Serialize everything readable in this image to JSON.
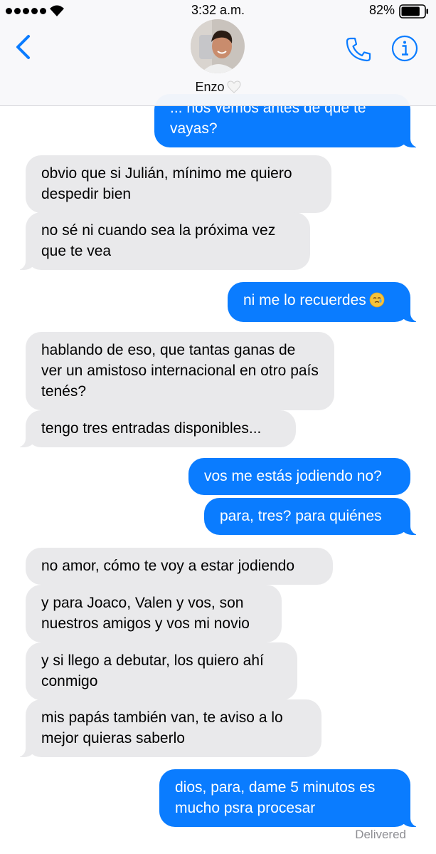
{
  "status_bar": {
    "time": "3:32 a.m.",
    "battery_percent": "82%",
    "battery_level": 0.82
  },
  "header": {
    "contact_name": "Enzo",
    "name_emoji_icon": "white-heart-icon",
    "back_icon": "chevron-left-icon",
    "call_icon": "phone-icon",
    "info_icon": "info-icon",
    "accent_color": "#0a7cff"
  },
  "messages": [
    {
      "from": "me",
      "text": "... nos vemos antes de que te vayas?"
    },
    {
      "from": "them",
      "text": "obvio que si Julián, mínimo me quiero despedir bien"
    },
    {
      "from": "them",
      "text": "no sé ni cuando sea la próxima vez que te vea"
    },
    {
      "from": "me",
      "text": "ni me lo recuerdes",
      "emoji": "face-holding-back-tears-icon"
    },
    {
      "from": "them",
      "text": "hablando de eso, que tantas ganas de ver un amistoso internacional en otro país tenés?"
    },
    {
      "from": "them",
      "text": "tengo tres entradas disponibles..."
    },
    {
      "from": "me",
      "text": "vos me estás jodiendo no?"
    },
    {
      "from": "me",
      "text": "para, tres? para quiénes"
    },
    {
      "from": "them",
      "text": "no amor, cómo te voy a estar jodiendo"
    },
    {
      "from": "them",
      "text": "y para Joaco, Valen y vos, son nuestros amigos y vos mi novio"
    },
    {
      "from": "them",
      "text": "y si llego a debutar, los quiero ahí conmigo"
    },
    {
      "from": "them",
      "text": "mis papás también van, te aviso a lo mejor quieras saberlo"
    },
    {
      "from": "me",
      "text": "dios, para, dame 5 minutos es mucho psra procesar"
    }
  ],
  "delivery_status": "Delivered",
  "colors": {
    "sent_bubble": "#0a7cff",
    "received_bubble": "#e9e9eb",
    "status_gray": "#8e8e93"
  }
}
